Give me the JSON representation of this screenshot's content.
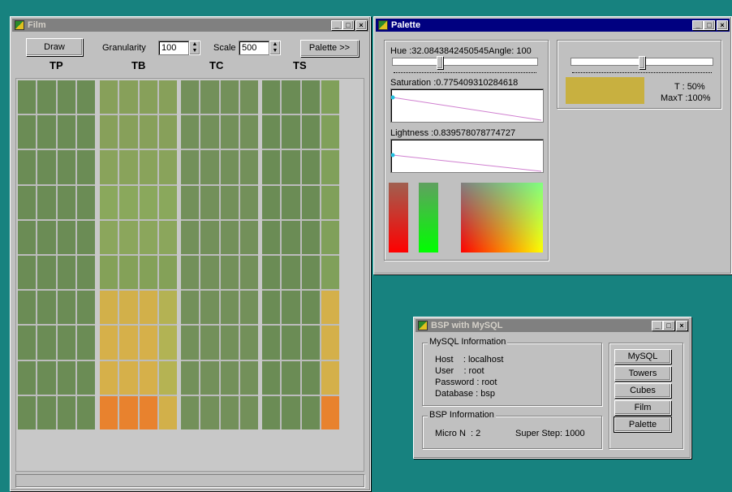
{
  "film": {
    "title": "Film",
    "draw_label": "Draw",
    "granularity_label": "Granularity",
    "granularity_value": "100",
    "scale_label": "Scale",
    "scale_value": "500",
    "palette_button": "Palette >>",
    "columns": [
      "TP",
      "TB",
      "TC",
      "TS"
    ],
    "cell_colors": {
      "TP": [
        "#6b8c55",
        "#6b8c55",
        "#6b8c55",
        "#6b8c55",
        "#6b8c55",
        "#6b8c55",
        "#6b8c55",
        "#6b8c55",
        "#6b8c55",
        "#6b8c55"
      ],
      "TB": [
        [
          "#87a05a",
          "#87a05a",
          "#87a05a",
          "#87a05a"
        ],
        [
          "#87a05a",
          "#87a05a",
          "#87a05a",
          "#87a05a"
        ],
        [
          "#89a35b",
          "#89a35b",
          "#89a35b",
          "#89a35b"
        ],
        [
          "#8aa85c",
          "#8aa85c",
          "#8aa85c",
          "#8aa85c"
        ],
        [
          "#8ba65c",
          "#8ba65c",
          "#8ba65c",
          "#8ba65c"
        ],
        [
          "#84a158",
          "#84a158",
          "#84a158",
          "#84a158"
        ],
        [
          "#d2b04a",
          "#d2b04a",
          "#d2b04a",
          "#b4b253"
        ],
        [
          "#d6b04a",
          "#d6b04a",
          "#d6b04a",
          "#b2b354"
        ],
        [
          "#d6b04a",
          "#d6b04a",
          "#d6b04a",
          "#b5b353"
        ],
        [
          "#e8822e",
          "#e8822e",
          "#e8822e",
          "#d2b04a"
        ]
      ],
      "TC": [
        "#73905a",
        "#73905a",
        "#73905a",
        "#73905a",
        "#73905a",
        "#73905a",
        "#73905a",
        "#73905a",
        "#73905a",
        "#73905a"
      ],
      "TS": [
        [
          "#6b8c55",
          "#6b8c55",
          "#6b8c55",
          "#80a05a"
        ],
        [
          "#6b8c55",
          "#6b8c55",
          "#6b8c55",
          "#80a05a"
        ],
        [
          "#6b8c55",
          "#6b8c55",
          "#6b8c55",
          "#80a05a"
        ],
        [
          "#6b8c55",
          "#6b8c55",
          "#6b8c55",
          "#80a05a"
        ],
        [
          "#6b8c55",
          "#6b8c55",
          "#6b8c55",
          "#80a05a"
        ],
        [
          "#6b8c55",
          "#6b8c55",
          "#6b8c55",
          "#80a05a"
        ],
        [
          "#6b8c55",
          "#6b8c55",
          "#6b8c55",
          "#d4b04a"
        ],
        [
          "#6b8c55",
          "#6b8c55",
          "#6b8c55",
          "#d4b04a"
        ],
        [
          "#6b8c55",
          "#6b8c55",
          "#6b8c55",
          "#d4b04a"
        ],
        [
          "#6b8c55",
          "#6b8c55",
          "#6b8c55",
          "#e8822e"
        ]
      ]
    }
  },
  "palette": {
    "title": "Palette",
    "hue_label": "Hue :32.0843842450545Angle: 100",
    "saturation_label": "Saturation :0.775409310284618",
    "lightness_label": "Lightness :0.839578078774727",
    "hue_slider_fraction": 0.32,
    "t_slider_fraction": 0.5,
    "t_label": "T : 50%",
    "maxt_label": "MaxT :100%",
    "swatch_color": "#c8b040"
  },
  "bsp": {
    "title": "BSP with MySQL",
    "mysql_group": "MySQL Information",
    "host": "Host    : localhost",
    "user": "User    : root",
    "password": "Password : root",
    "database": "Database : bsp",
    "bsp_group": "BSP Information",
    "micro_n": "Micro N  : 2",
    "super_step": "Super Step: 1000",
    "buttons": [
      "MySQL",
      "Towers",
      "Cubes",
      "Film",
      "Palette"
    ]
  }
}
